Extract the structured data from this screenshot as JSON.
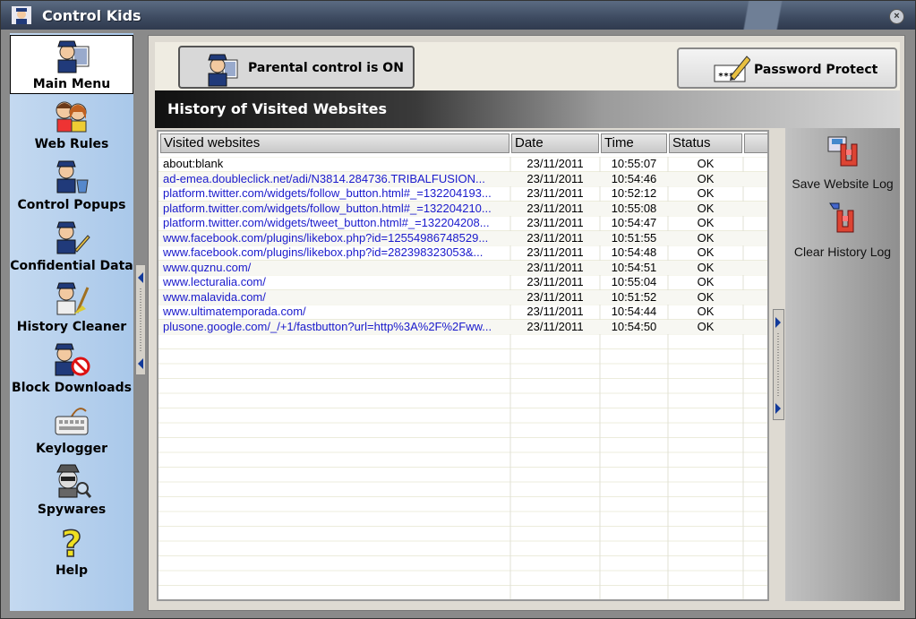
{
  "window": {
    "title": "Control Kids",
    "close_label": "×"
  },
  "sidebar": {
    "items": [
      {
        "label": "Main Menu"
      },
      {
        "label": "Web Rules"
      },
      {
        "label": "Control Popups"
      },
      {
        "label": "Confidential Data"
      },
      {
        "label": "History Cleaner"
      },
      {
        "label": "Block Downloads"
      },
      {
        "label": "Keylogger"
      },
      {
        "label": "Spywares"
      },
      {
        "label": "Help"
      }
    ]
  },
  "toolbar": {
    "parental_label": "Parental control is ON",
    "password_label": "Password Protect"
  },
  "panel": {
    "title": "History of Visited Websites"
  },
  "table": {
    "headers": {
      "url": "Visited websites",
      "date": "Date",
      "time": "Time",
      "status": "Status"
    },
    "rows": [
      {
        "url": "about:blank",
        "date": "23/11/2011",
        "time": "10:55:07",
        "status": "OK"
      },
      {
        "url": "ad-emea.doubleclick.net/adi/N3814.284736.TRIBALFUSION...",
        "date": "23/11/2011",
        "time": "10:54:46",
        "status": "OK"
      },
      {
        "url": "platform.twitter.com/widgets/follow_button.html#_=132204193...",
        "date": "23/11/2011",
        "time": "10:52:12",
        "status": "OK"
      },
      {
        "url": "platform.twitter.com/widgets/follow_button.html#_=132204210...",
        "date": "23/11/2011",
        "time": "10:55:08",
        "status": "OK"
      },
      {
        "url": "platform.twitter.com/widgets/tweet_button.html#_=132204208...",
        "date": "23/11/2011",
        "time": "10:54:47",
        "status": "OK"
      },
      {
        "url": "www.facebook.com/plugins/likebox.php?id=12554986748529...",
        "date": "23/11/2011",
        "time": "10:51:55",
        "status": "OK"
      },
      {
        "url": "www.facebook.com/plugins/likebox.php?id=282398323053&...",
        "date": "23/11/2011",
        "time": "10:54:48",
        "status": "OK"
      },
      {
        "url": "www.quznu.com/",
        "date": "23/11/2011",
        "time": "10:54:51",
        "status": "OK"
      },
      {
        "url": "www.lecturalia.com/",
        "date": "23/11/2011",
        "time": "10:55:04",
        "status": "OK"
      },
      {
        "url": "www.malavida.com/",
        "date": "23/11/2011",
        "time": "10:51:52",
        "status": "OK"
      },
      {
        "url": "www.ultimatemporada.com/",
        "date": "23/11/2011",
        "time": "10:54:44",
        "status": "OK"
      },
      {
        "url": "plusone.google.com/_/+1/fastbutton?url=http%3A%2F%2Fww...",
        "date": "23/11/2011",
        "time": "10:54:50",
        "status": "OK"
      }
    ]
  },
  "actions": {
    "save_label": "Save Website Log",
    "clear_label": "Clear History Log"
  },
  "colors": {
    "link": "#1a1acc",
    "sidebar": "#b3cfee",
    "title_bar": "#3d4a60"
  }
}
